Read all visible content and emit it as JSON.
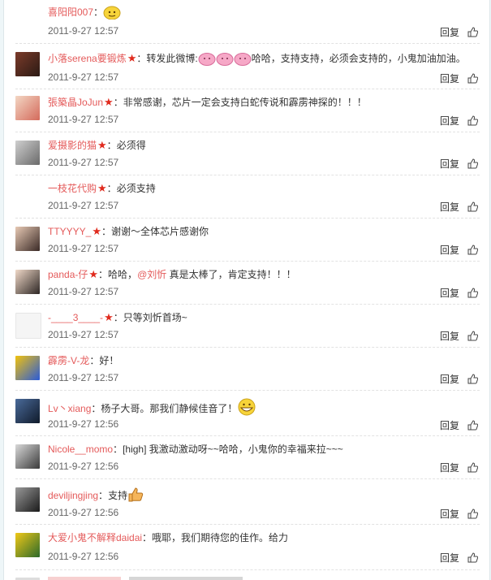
{
  "comments": [
    {
      "name": "喜阳阳007",
      "text": "",
      "time": "2011-9-27 12:57",
      "reply": "回复",
      "star": false
    },
    {
      "name": "小落serena要锻炼",
      "text": "转发此微博:",
      "text2": "哈哈，支持支持，必须会支持的，小鬼加油加油。",
      "time": "2011-9-27 12:57",
      "reply": "回复",
      "star": true
    },
    {
      "name": "張築晶JoJun",
      "text": "非常感谢，芯片一定会支持白蛇传说和霹雳神探的！！！",
      "time": "2011-9-27 12:57",
      "reply": "回复",
      "star": true
    },
    {
      "name": "爱摄影的猫",
      "text": "必须得",
      "time": "2011-9-27 12:57",
      "reply": "回复",
      "star": true
    },
    {
      "name": "一枝花代购",
      "text": "必须支持",
      "time": "2011-9-27 12:57",
      "reply": "回复",
      "star": true
    },
    {
      "name": "TTYYYY_",
      "text": "谢谢～全体芯片感谢你",
      "time": "2011-9-27 12:57",
      "reply": "回复",
      "star": true
    },
    {
      "name": "panda-仔",
      "text": "哈哈，",
      "mention": "@刘忻",
      "text2": " 真是太棒了，肯定支持！！！",
      "time": "2011-9-27 12:57",
      "reply": "回复",
      "star": true
    },
    {
      "name": "-____3____-",
      "text": "只等刘忻首场~",
      "time": "2011-9-27 12:57",
      "reply": "回复",
      "star": true
    },
    {
      "name": "霹雳-V-龙",
      "text": "好！",
      "time": "2011-9-27 12:57",
      "reply": "回复",
      "star": false
    },
    {
      "name": "Lv丶xiang",
      "text": "杨子大哥。那我们静候佳音了！",
      "time": "2011-9-27 12:56",
      "reply": "回复",
      "star": false
    },
    {
      "name": "Nicole__momo",
      "text": "[high] 我激动激动呀~~哈哈，小鬼你的幸福来拉~~~",
      "time": "2011-9-27 12:56",
      "reply": "回复",
      "star": false
    },
    {
      "name": "deviljingjing",
      "text": "支持",
      "time": "2011-9-27 12:56",
      "reply": "回复",
      "star": false
    },
    {
      "name": "大爱小鬼不解释daidai",
      "text": "哦耶，我们期待您的佳作。给力",
      "time": "2011-9-27 12:56",
      "reply": "回复",
      "star": false
    },
    {
      "name": "",
      "text": "",
      "time": "",
      "reply": "",
      "star": false
    }
  ]
}
